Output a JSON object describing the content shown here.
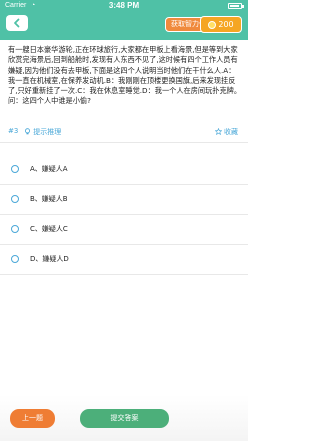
{
  "status_bar": {
    "carrier": "Carrier",
    "wifi": "◔",
    "time": "3:48 PM"
  },
  "header": {
    "wisdom_button": "获取智力值",
    "coins": "200"
  },
  "question": {
    "text": "有一艘日本豪华游轮,正在环球旅行,大家都在甲板上看海景,但是等到大家欣赏完海景后,回到船舱时,发现有人东西不见了,这时候有四个工作人员有嫌疑,因为他们没有去甲板,下面是这四个人说明当时他们在干什么人.A：我一直在机械室,在保养发动机.B：我刚刚在顶楼更换国旗,后来发现挂反了,只好重新挂了一次.C：我在休息室睡觉.D：我一个人在房间玩扑克牌。问：这四个人中谁是小偷?",
    "number": "#3",
    "hint_label": "提示推理",
    "favorite_label": "收藏"
  },
  "options": [
    {
      "label": "A、嫌疑人A"
    },
    {
      "label": "B、嫌疑人B"
    },
    {
      "label": "C、嫌疑人C"
    },
    {
      "label": "D、嫌疑人D"
    }
  ],
  "footer": {
    "prev_label": "上一题",
    "submit_label": "提交答案"
  },
  "colors": {
    "header": "#4fc1a6",
    "accent_blue": "#4aa8d8",
    "orange": "#ef7d34",
    "green": "#4caf7a",
    "gold": "#f5a623"
  },
  "icons": {
    "back": "chevron-left-icon",
    "coin": "coin-icon",
    "hint": "bulb-icon",
    "favorite": "star-icon",
    "wifi": "wifi-icon",
    "battery": "battery-icon"
  }
}
